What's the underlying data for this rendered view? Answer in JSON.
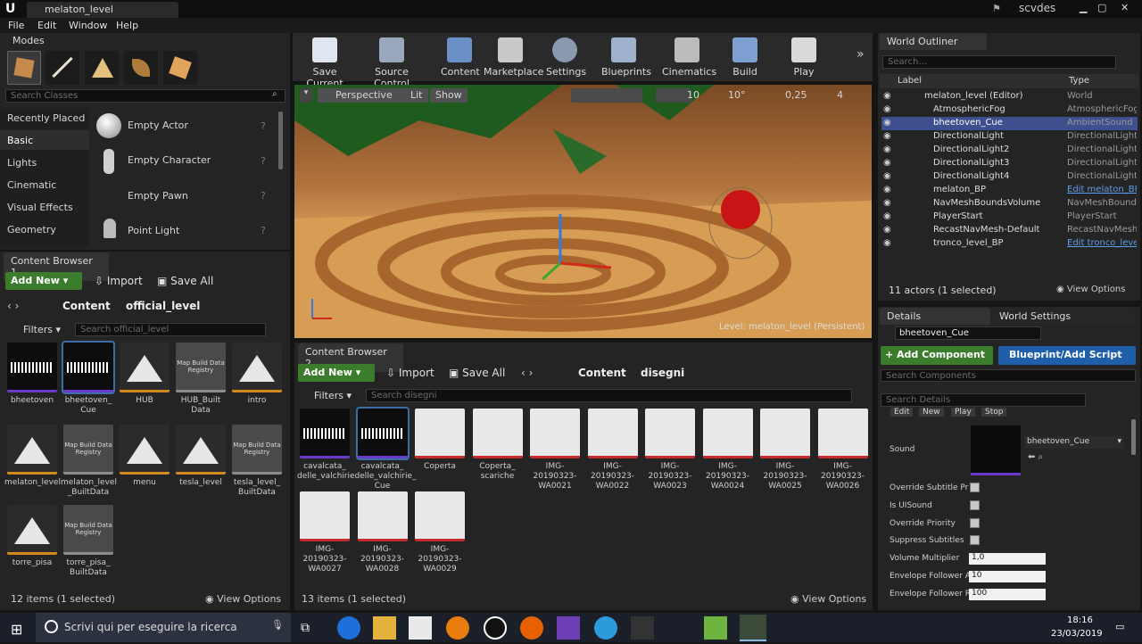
{
  "window": {
    "title": "melaton_level",
    "user": "scvdes"
  },
  "menu": [
    "File",
    "Edit",
    "Window",
    "Help"
  ],
  "modes": {
    "title": "Modes",
    "search_placeholder": "Search Classes",
    "categories": [
      "Recently Placed",
      "Basic",
      "Lights",
      "Cinematic",
      "Visual Effects",
      "Geometry"
    ],
    "items": [
      "Empty Actor",
      "Empty Character",
      "Empty Pawn",
      "Point Light"
    ]
  },
  "toolbar": [
    "Save Current",
    "Source Control",
    "Content",
    "Marketplace",
    "Settings",
    "Blueprints",
    "Cinematics",
    "Build",
    "Play"
  ],
  "viewport": {
    "perspective": "Perspective",
    "lit": "Lit",
    "show": "Show",
    "grid": "10",
    "angle": "10°",
    "scale": "0,25",
    "cams": "4",
    "level_label": "Level:",
    "level_name": "melaton_level (Persistent)"
  },
  "cb1": {
    "tab": "Content Browser 1",
    "add_new": "Add New",
    "import": "Import",
    "save_all": "Save All",
    "path": [
      "Content",
      "official_level"
    ],
    "filters": "Filters",
    "search_placeholder": "Search official_level",
    "assets": [
      "bheetoven",
      "bheetoven_\nCue",
      "HUB",
      "HUB_Built\nData",
      "intro",
      "melaton_level",
      "melaton_level\n_BuiltData",
      "menu",
      "tesla_level",
      "tesla_level_\nBuiltData",
      "torre_pisa",
      "torre_pisa_\nBuiltData"
    ],
    "status": "12 items (1 selected)",
    "view_options": "View Options"
  },
  "cb2": {
    "tab": "Content Browser 2",
    "add_new": "Add New",
    "import": "Import",
    "save_all": "Save All",
    "path": [
      "Content",
      "disegni"
    ],
    "filters": "Filters",
    "search_placeholder": "Search disegni",
    "assets": [
      "cavalcata_\ndelle_valchirie",
      "cavalcata_\ndelle_valchirie_\nCue",
      "Coperta",
      "Coperta_\nscariche",
      "IMG-\n20190323-\nWA0021",
      "IMG-\n20190323-\nWA0022",
      "IMG-\n20190323-\nWA0023",
      "IMG-\n20190323-\nWA0024",
      "IMG-\n20190323-\nWA0025",
      "IMG-\n20190323-\nWA0026",
      "IMG-\n20190323-\nWA0027",
      "IMG-\n20190323-\nWA0028",
      "IMG-\n20190323-\nWA0029"
    ],
    "status": "13 items (1 selected)",
    "view_options": "View Options"
  },
  "registry_thumb": "Map Build\nData Registry",
  "outliner": {
    "title": "World Outliner",
    "search_placeholder": "Search...",
    "col_label": "Label",
    "col_type": "Type",
    "rows": [
      [
        "melaton_level (Editor)",
        "World"
      ],
      [
        "AtmosphericFog",
        "AtmosphericFog"
      ],
      [
        "bheetoven_Cue",
        "AmbientSound"
      ],
      [
        "DirectionalLight",
        "DirectionalLight"
      ],
      [
        "DirectionalLight2",
        "DirectionalLight"
      ],
      [
        "DirectionalLight3",
        "DirectionalLight"
      ],
      [
        "DirectionalLight4",
        "DirectionalLight"
      ],
      [
        "melaton_BP",
        "Edit melaton_BP"
      ],
      [
        "NavMeshBoundsVolume",
        "NavMeshBounds"
      ],
      [
        "PlayerStart",
        "PlayerStart"
      ],
      [
        "RecastNavMesh-Default",
        "RecastNavMesh"
      ],
      [
        "tronco_level_BP",
        "Edit tronco_leve"
      ]
    ],
    "status": "11 actors (1 selected)",
    "view_options": "View Options"
  },
  "details": {
    "tab": "Details",
    "tab2": "World Settings",
    "name": "bheetoven_Cue",
    "add_component": "+ Add Component",
    "blueprint": "Blueprint/Add Script",
    "search_components": "Search Components",
    "search_details": "Search Details",
    "buttons": [
      "Edit",
      "New",
      "Play",
      "Stop"
    ],
    "sound_label": "Sound",
    "sound_value": "bheetoven_Cue",
    "props": [
      "Override Subtitle Pr",
      "Is UISound",
      "Override Priority",
      "Suppress Subtitles",
      "Volume Multiplier",
      "Envelope Follower A",
      "Envelope Follower R"
    ],
    "values": [
      "1,0",
      "10",
      "100"
    ]
  },
  "taskbar": {
    "search": "Scrivi qui per eseguire la ricerca",
    "time": "18:16",
    "date": "23/03/2019"
  }
}
